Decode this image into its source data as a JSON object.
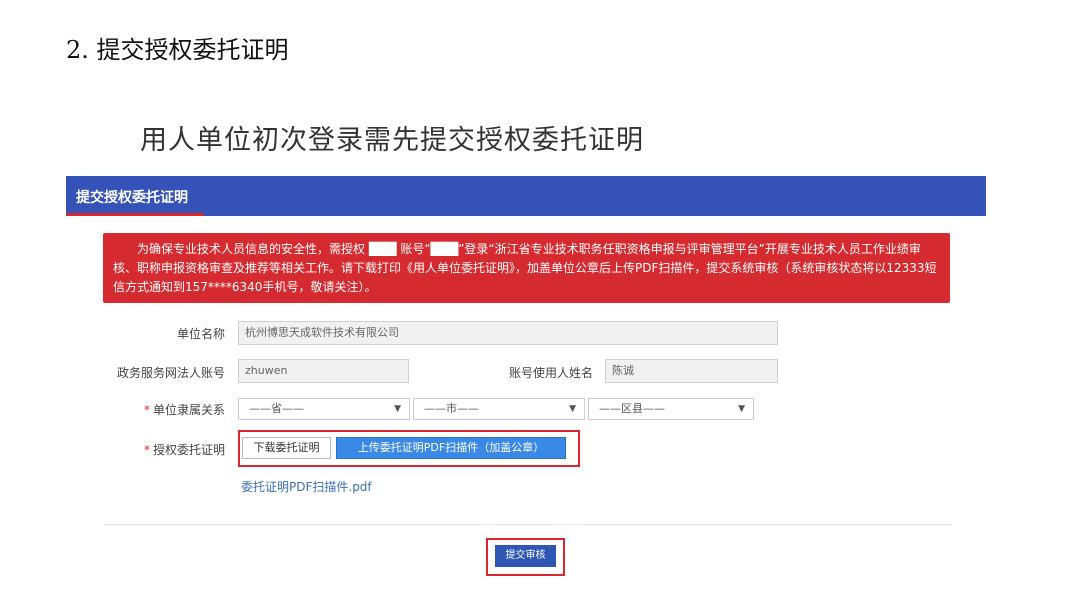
{
  "doc_heading": "2.  提交授权委托证明",
  "doc_subtitle": "用人单位初次登录需先提交授权委托证明",
  "panel": {
    "title": "提交授权委托证明"
  },
  "alert": {
    "text": "为确保专业技术人员信息的安全性，需授权 ███ 账号“███”登录“浙江省专业技术职务任职资格申报与评审管理平台”开展专业技术人员工作业绩审核、职称申报资格审查及推荐等相关工作。请下载打印《用人单位委托证明》，加盖单位公章后上传PDF扫描件，提交系统审核（系统审核状态将以12333短信方式通知到157****6340手机号，敬请关注）。"
  },
  "form": {
    "unit_name_label": "单位名称",
    "unit_name_value": "杭州博思天成软件技术有限公司",
    "legal_account_label": "政务服务网法人账号",
    "legal_account_value": "zhuwen",
    "account_user_label": "账号使用人姓名",
    "account_user_value": "陈诚",
    "required_mark": "*",
    "affiliation_label": "单位隶属关系",
    "province": "——省——",
    "city": "——市——",
    "district": "——区县——",
    "auth_label": "授权委托证明",
    "download_button": "下载委托证明",
    "upload_button": "上传委托证明PDF扫描件（加盖公章）",
    "file_link": "委托证明PDF扫描件.pdf",
    "submit_button": "提交审核"
  },
  "colors": {
    "header_blue": "#3552b8",
    "alert_red": "#d52b30",
    "highlight_red": "#d9262c",
    "upload_blue": "#3a89e6",
    "submit_blue": "#2f56b5"
  }
}
